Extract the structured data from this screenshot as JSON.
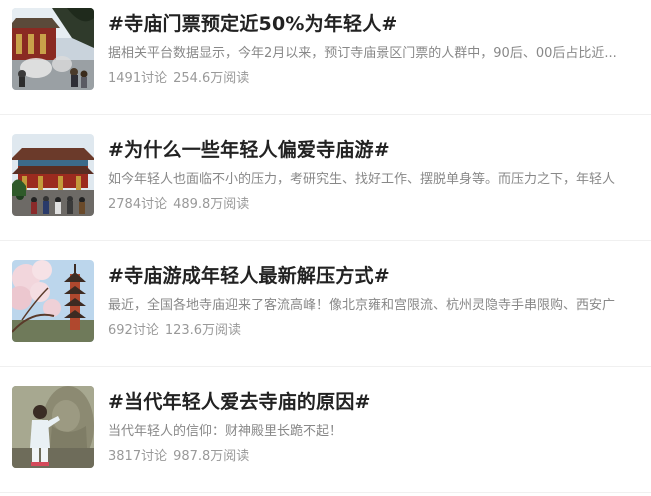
{
  "topics": [
    {
      "thumbnail_icon": "temple-courtyard-photo",
      "title": "#寺庙门票预定近50%为年轻人#",
      "summary": "据相关平台数据显示，今年2月以来，预订寺庙景区门票的人群中，90后、00后占比近...",
      "discussions": "1491讨论",
      "reads": "254.6万阅读"
    },
    {
      "thumbnail_icon": "temple-hall-crowd-photo",
      "title": "#为什么一些年轻人偏爱寺庙游#",
      "summary": "如今年轻人也面临不小的压力，考研究生、找好工作、摆脱单身等。而压力之下，年轻人",
      "discussions": "2784讨论",
      "reads": "489.8万阅读"
    },
    {
      "thumbnail_icon": "pagoda-blossom-photo",
      "title": "#寺庙游成年轻人最新解压方式#",
      "summary": "最近，全国各地寺庙迎来了客流高峰！像北京雍和宫限流、杭州灵隐寺手串限购、西安广",
      "discussions": "692讨论",
      "reads": "123.6万阅读"
    },
    {
      "thumbnail_icon": "statue-prayer-photo",
      "title": "#当代年轻人爱去寺庙的原因#",
      "summary": "当代年轻人的信仰：财神殿里长跪不起！",
      "discussions": "3817讨论",
      "reads": "987.8万阅读"
    }
  ]
}
